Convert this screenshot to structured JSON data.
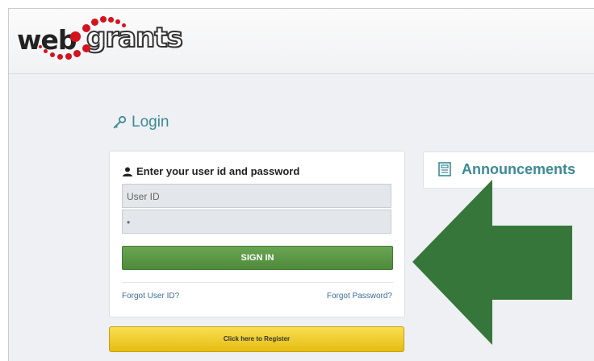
{
  "brand": {
    "logo_text_web": "web",
    "logo_text_grants": "grants",
    "logo_color": "#d3141e"
  },
  "login": {
    "title": "Login",
    "title_icon": "key-icon",
    "heading": "Enter your user id and password",
    "heading_icon": "user-icon",
    "user_id_placeholder": "User ID",
    "password_value": "•",
    "sign_in_label": "SIGN IN",
    "forgot_user_label": "Forgot User ID?",
    "forgot_password_label": "Forgot Password?",
    "register_label": "Click here to Register",
    "accent_color": "#3c8a95",
    "sign_in_color": "#5a9a45",
    "register_color": "#f0cc2c"
  },
  "announcements": {
    "label": "Announcements",
    "icon": "document-icon"
  },
  "overlay": {
    "icon": "arrow-left-icon",
    "color": "#37763a"
  }
}
